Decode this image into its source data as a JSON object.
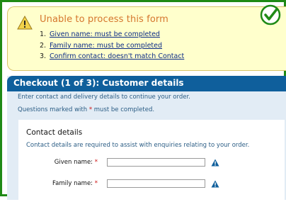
{
  "error_panel": {
    "icon": "warning-icon",
    "title": "Unable to process this form",
    "errors": [
      {
        "number": "1.",
        "text": "Given name: must be completed"
      },
      {
        "number": "2.",
        "text": "Family name: must be completed"
      },
      {
        "number": "3.",
        "text": "Confirm contact: doesn't match Contact"
      }
    ]
  },
  "status_badge": {
    "icon": "checkmark-icon",
    "color": "#1f8a16"
  },
  "checkout": {
    "title": "Checkout (1 of 3): Customer details",
    "intro": "Enter contact and delivery details to continue your order.",
    "required_note_before": "Questions marked with ",
    "required_star": "*",
    "required_note_after": " must be completed."
  },
  "contact": {
    "heading": "Contact details",
    "description": "Contact details are required to assist with enquiries relating to your order.",
    "fields": [
      {
        "label": "Given name:",
        "star": "*",
        "value": "",
        "warning_icon": "warning-icon"
      },
      {
        "label": "Family name:",
        "star": "*",
        "value": "",
        "warning_icon": "warning-icon"
      }
    ]
  },
  "colors": {
    "frame_border": "#1f8a16",
    "error_background": "#ffffcc",
    "error_title": "#d5762d",
    "header_background": "#0f5f9c",
    "panel_background": "#e2ecf5",
    "required_star": "#cc1111",
    "warning_icon": "#0f5f9c"
  }
}
